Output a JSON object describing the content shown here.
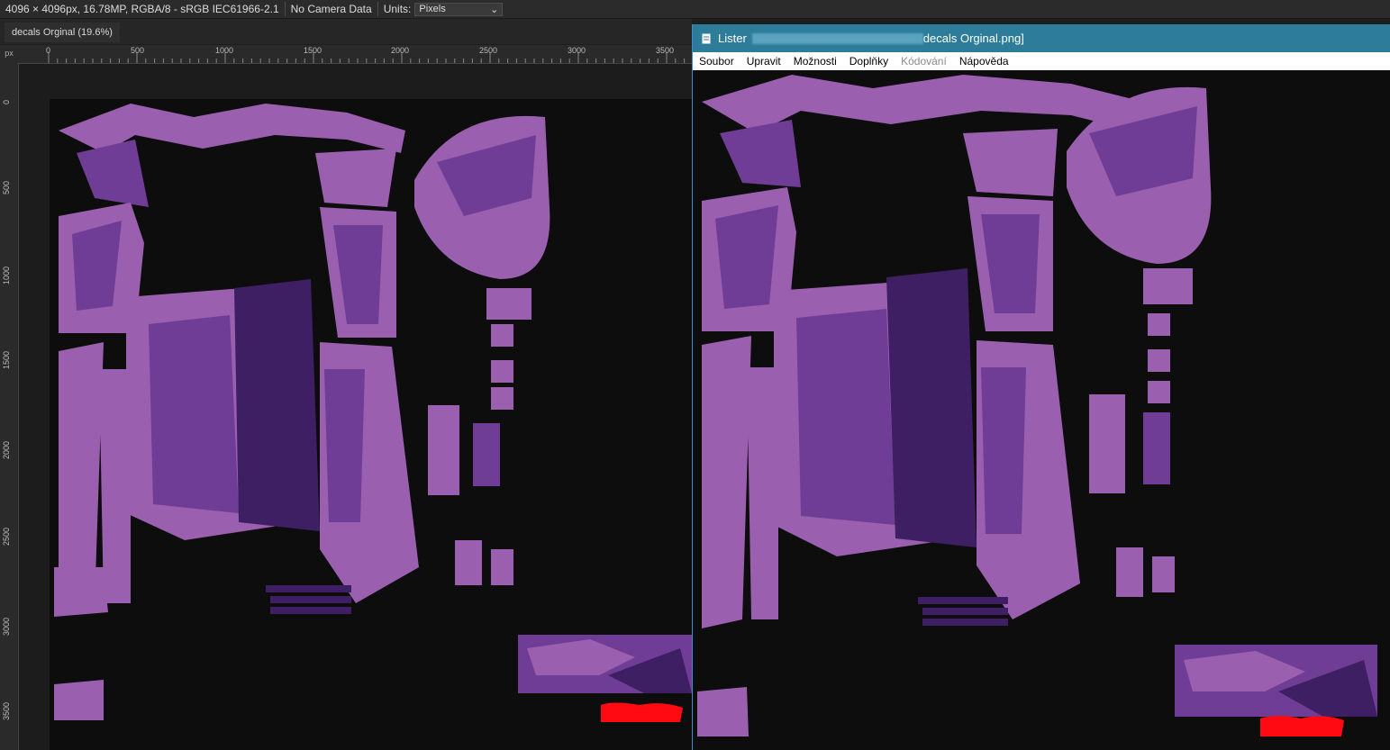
{
  "context_bar": {
    "doc_info": "4096 × 4096px, 16.78MP, RGBA/8 - sRGB IEC61966-2.1",
    "camera": "No Camera Data",
    "units_label": "Units:",
    "units_value": "Pixels"
  },
  "document_tab": {
    "label": "decals Orginal (19.6%)"
  },
  "ruler": {
    "unit": "px",
    "h_labels": [
      "0",
      "500",
      "1000",
      "1500",
      "2000",
      "2500",
      "3000",
      "3500"
    ],
    "v_labels": [
      "0",
      "500",
      "1000",
      "1500",
      "2000",
      "2500",
      "3000",
      "3500"
    ]
  },
  "lister": {
    "title_prefix": "Lister",
    "title_suffix": "decals Orginal.png]",
    "menu": [
      {
        "label": "Soubor",
        "enabled": true
      },
      {
        "label": "Upravit",
        "enabled": true
      },
      {
        "label": "Možnosti",
        "enabled": true
      },
      {
        "label": "Doplňky",
        "enabled": true
      },
      {
        "label": "Kódování",
        "enabled": false
      },
      {
        "label": "Nápověda",
        "enabled": true
      }
    ]
  },
  "colors": {
    "purple_light": "#9b5fb0",
    "purple_mid": "#6f3d95",
    "purple_dark": "#3e1f63",
    "red": "#ff0a12",
    "lister_title": "#2d7d9a"
  }
}
